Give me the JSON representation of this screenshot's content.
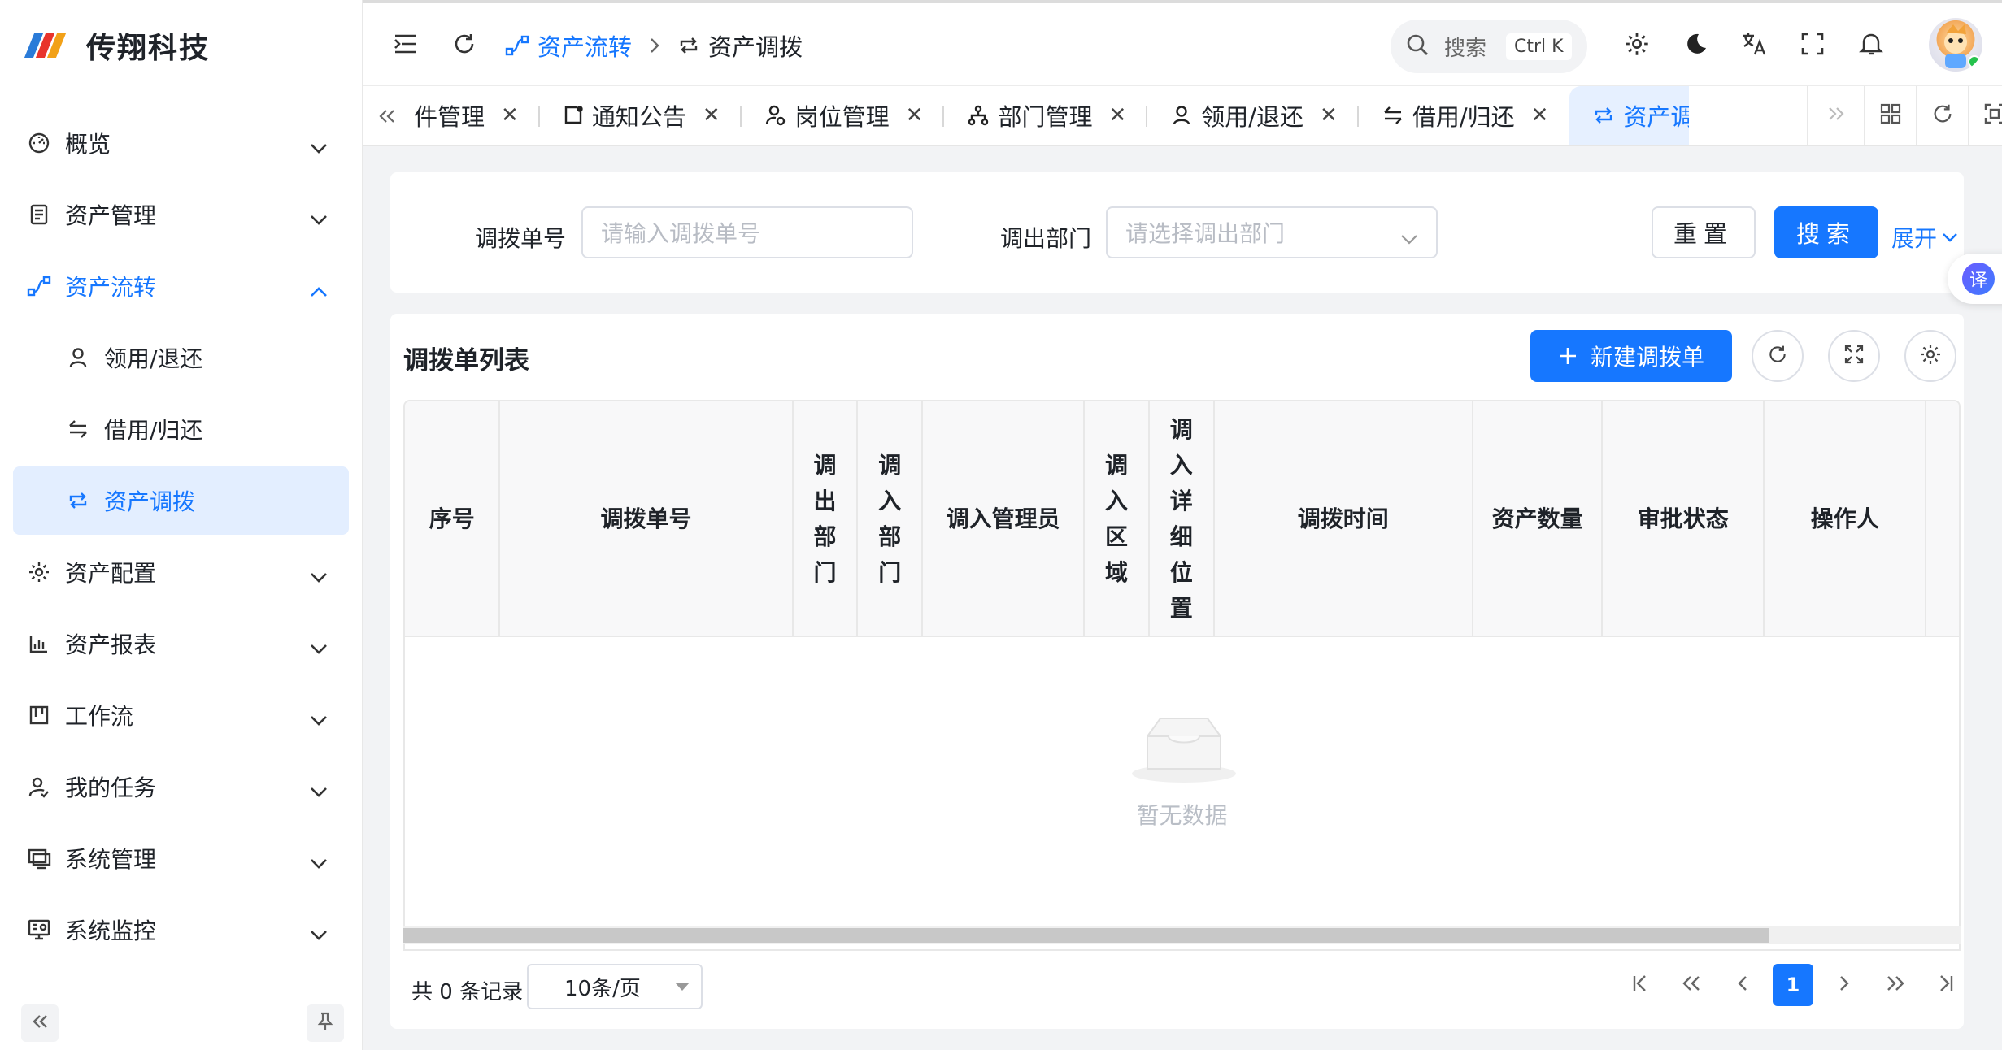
{
  "brand": {
    "name": "传翔科技",
    "colors": [
      "#2a7bd8",
      "#e8342c",
      "#f2a118"
    ]
  },
  "sidebar": {
    "items": [
      {
        "label": "概览",
        "icon": "dashboard-icon",
        "expanded": false
      },
      {
        "label": "资产管理",
        "icon": "document-icon",
        "expanded": false
      },
      {
        "label": "资产流转",
        "icon": "flow-icon",
        "expanded": true,
        "children": [
          {
            "label": "领用/退还",
            "icon": "user-icon"
          },
          {
            "label": "借用/归还",
            "icon": "swap-icon"
          },
          {
            "label": "资产调拨",
            "icon": "transfer-icon",
            "active": true
          }
        ]
      },
      {
        "label": "资产配置",
        "icon": "gear-icon",
        "expanded": false
      },
      {
        "label": "资产报表",
        "icon": "bar-chart-icon",
        "expanded": false
      },
      {
        "label": "工作流",
        "icon": "board-icon",
        "expanded": false
      },
      {
        "label": "我的任务",
        "icon": "user-task-icon",
        "expanded": false
      },
      {
        "label": "系统管理",
        "icon": "monitor-icon",
        "expanded": false
      },
      {
        "label": "系统监控",
        "icon": "monitor-settings-icon",
        "expanded": false
      }
    ]
  },
  "header": {
    "breadcrumb": [
      "资产流转",
      "资产调拨"
    ],
    "search_placeholder": "搜索",
    "search_shortcut": "Ctrl K"
  },
  "tabs": [
    {
      "label": "件管理",
      "icon": "",
      "active": false
    },
    {
      "label": "通知公告",
      "icon": "notice-icon",
      "active": false
    },
    {
      "label": "岗位管理",
      "icon": "post-icon",
      "active": false
    },
    {
      "label": "部门管理",
      "icon": "tree-icon",
      "active": false
    },
    {
      "label": "领用/退还",
      "icon": "user-icon",
      "active": false
    },
    {
      "label": "借用/归还",
      "icon": "swap-icon",
      "active": false
    },
    {
      "label": "资产调拨",
      "icon": "transfer-icon",
      "active": true
    }
  ],
  "filter": {
    "transfer_no_label": "调拨单号",
    "transfer_no_placeholder": "请输入调拨单号",
    "out_dept_label": "调出部门",
    "out_dept_placeholder": "请选择调出部门",
    "reset_label": "重置",
    "search_label": "搜索",
    "expand_label": "展开"
  },
  "float_translate": "译",
  "list": {
    "title": "调拨单列表",
    "new_button": "新建调拨单",
    "columns": [
      "序号",
      "调拨单号",
      "调出部门",
      "调入部门",
      "调入管理员",
      "调入区域",
      "调入详细位置",
      "调拨时间",
      "资产数量",
      "审批状态",
      "操作人"
    ],
    "rows": [],
    "empty_text": "暂无数据"
  },
  "pagination": {
    "total_text": "共 0 条记录",
    "page_size": "10条/页",
    "current_page": "1"
  }
}
